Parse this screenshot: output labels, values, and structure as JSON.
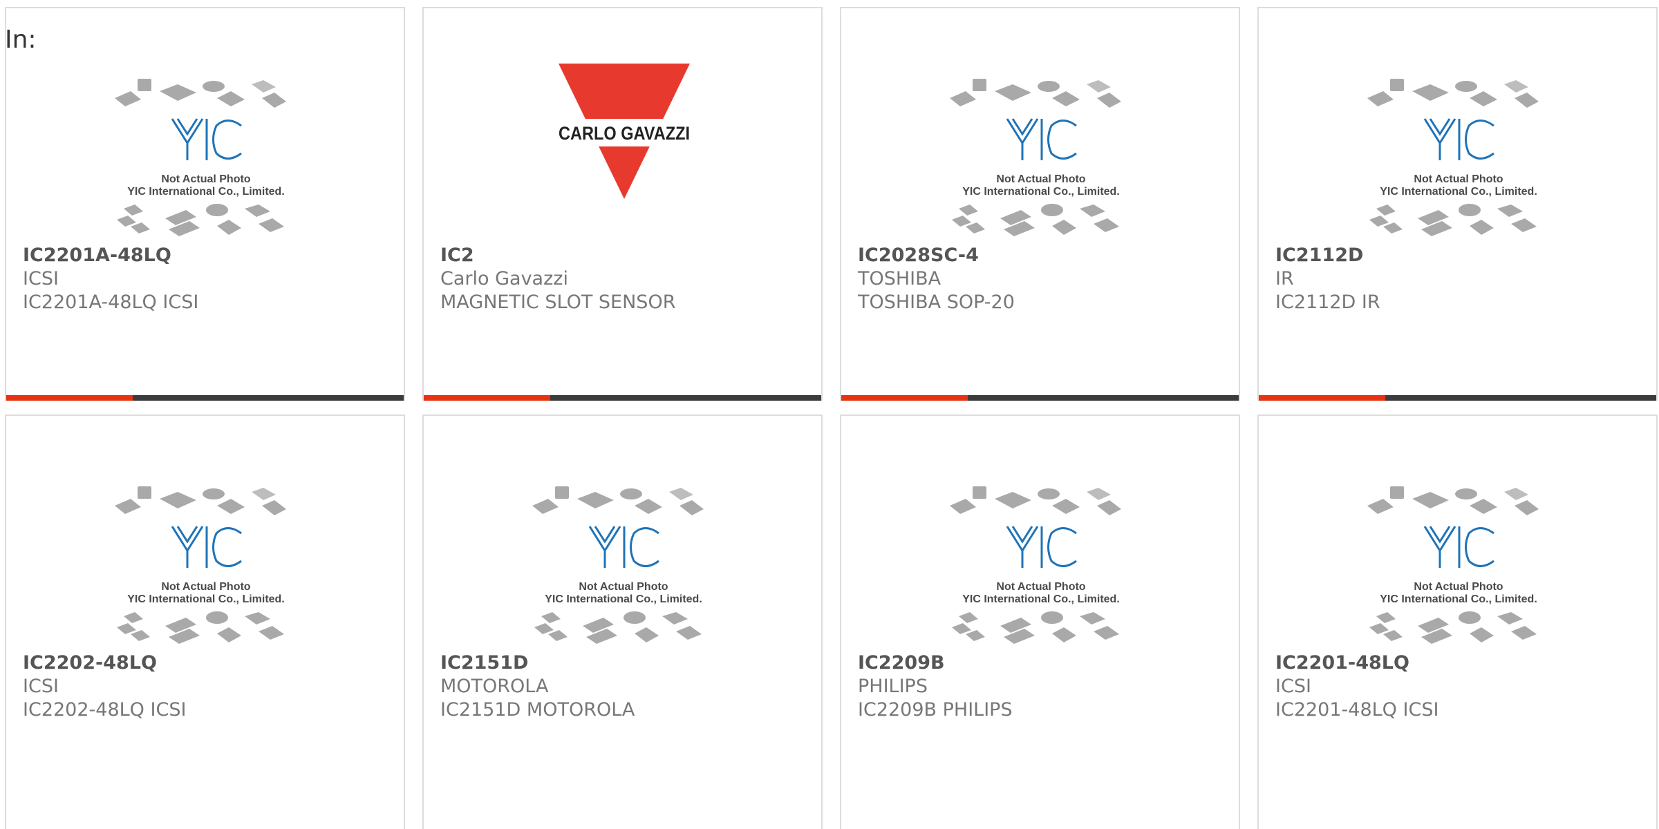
{
  "page": {
    "label": "In:"
  },
  "placeholder": {
    "line1": "Not Actual Photo",
    "line2": "YIC International Co., Limited.",
    "logo": "YIC"
  },
  "brand_logo": {
    "text": "CARLO GAVAZZI",
    "color": "#e8392f"
  },
  "colors": {
    "accent": "#e63312",
    "bar": "#3b3b3b"
  },
  "products": [
    {
      "part": "IC2201A-48LQ",
      "maker": "ICSI",
      "desc": "IC2201A-48LQ ICSI",
      "image": "placeholder"
    },
    {
      "part": "IC2",
      "maker": "Carlo Gavazzi",
      "desc": "MAGNETIC SLOT SENSOR",
      "image": "carlo-gavazzi-logo"
    },
    {
      "part": "IC2028SC-4",
      "maker": "TOSHIBA",
      "desc": "TOSHIBA SOP-20",
      "image": "placeholder"
    },
    {
      "part": "IC2112D",
      "maker": "IR",
      "desc": "IC2112D IR",
      "image": "placeholder"
    },
    {
      "part": "IC2202-48LQ",
      "maker": "ICSI",
      "desc": "IC2202-48LQ ICSI",
      "image": "placeholder"
    },
    {
      "part": "IC2151D",
      "maker": "MOTOROLA",
      "desc": "IC2151D MOTOROLA",
      "image": "placeholder"
    },
    {
      "part": "IC2209B",
      "maker": "PHILIPS",
      "desc": "IC2209B PHILIPS",
      "image": "placeholder"
    },
    {
      "part": "IC2201-48LQ",
      "maker": "ICSI",
      "desc": "IC2201-48LQ ICSI",
      "image": "placeholder"
    }
  ]
}
